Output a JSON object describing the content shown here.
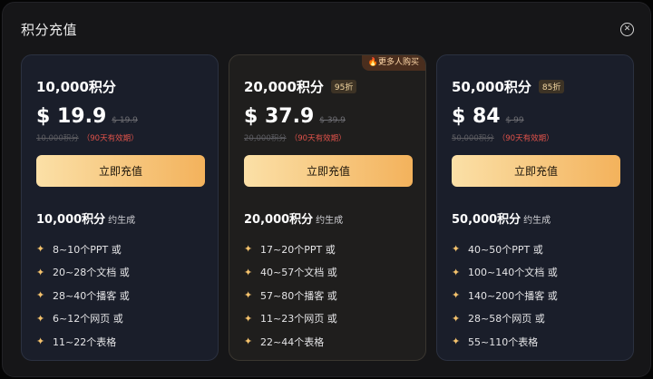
{
  "dialog": {
    "title": "积分充值",
    "close_icon": "close-icon"
  },
  "plans": [
    {
      "points_title": "10,000积分",
      "discount": "",
      "tag": "",
      "price": "$ 19.9",
      "original_price": "$ 19.9",
      "points_strike": "10,000积分",
      "validity": "（90天有效期）",
      "button": "立即充值",
      "gen_points": "10,000积分",
      "gen_suffix": "约生成",
      "features": [
        "8~10个PPT 或",
        "20~28个文档 或",
        "28~40个播客 或",
        "6~12个网页 或",
        "11~22个表格"
      ]
    },
    {
      "points_title": "20,000积分",
      "discount": "95折",
      "tag": "🔥更多人购买",
      "price": "$ 37.9",
      "original_price": "$ 39.9",
      "points_strike": "20,000积分",
      "validity": "（90天有效期）",
      "button": "立即充值",
      "gen_points": "20,000积分",
      "gen_suffix": "约生成",
      "features": [
        "17~20个PPT 或",
        "40~57个文档 或",
        "57~80个播客 或",
        "11~23个网页 或",
        "22~44个表格"
      ]
    },
    {
      "points_title": "50,000积分",
      "discount": "85折",
      "tag": "",
      "price": "$ 84",
      "original_price": "$ 99",
      "points_strike": "50,000积分",
      "validity": "（90天有效期）",
      "button": "立即充值",
      "gen_points": "50,000积分",
      "gen_suffix": "约生成",
      "features": [
        "40~50个PPT 或",
        "100~140个文档 或",
        "140~200个播客 或",
        "28~58个网页 或",
        "55~110个表格"
      ]
    }
  ],
  "colors": {
    "accent_gradient_start": "#fbe0a7",
    "accent_gradient_end": "#f3b25c",
    "validity_red": "#e0524a",
    "star_gold": "#f4c26c"
  }
}
